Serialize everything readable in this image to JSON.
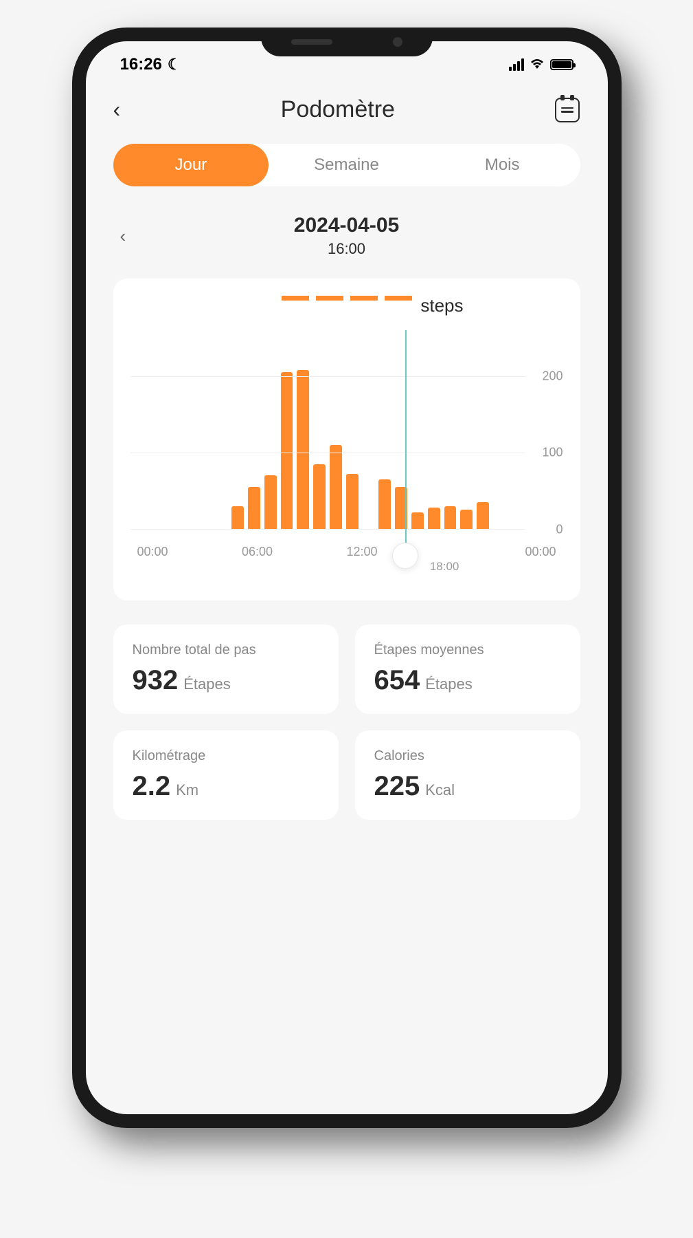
{
  "statusBar": {
    "time": "16:26"
  },
  "header": {
    "title": "Podomètre"
  },
  "tabs": [
    {
      "label": "Jour",
      "active": true
    },
    {
      "label": "Semaine",
      "active": false
    },
    {
      "label": "Mois",
      "active": false
    }
  ],
  "dateNav": {
    "date": "2024-04-05",
    "time": "16:00"
  },
  "chart_data": {
    "type": "bar",
    "tooltip_label": "steps",
    "categories": [
      "00:00",
      "01:00",
      "02:00",
      "03:00",
      "04:00",
      "05:00",
      "06:00",
      "07:00",
      "08:00",
      "09:00",
      "10:00",
      "11:00",
      "12:00",
      "13:00",
      "14:00",
      "15:00",
      "16:00",
      "17:00",
      "18:00",
      "19:00",
      "20:00",
      "21:00",
      "22:00",
      "23:00"
    ],
    "values": [
      0,
      0,
      0,
      0,
      0,
      0,
      30,
      55,
      70,
      205,
      208,
      85,
      110,
      72,
      0,
      65,
      55,
      22,
      28,
      30,
      25,
      35,
      0,
      0
    ],
    "xticks": [
      "00:00",
      "06:00",
      "12:00",
      "",
      "00:00"
    ],
    "cursor_xlabel": "18:00",
    "cursor_index": 16.2,
    "yticks": [
      0,
      100,
      200
    ],
    "ylim": [
      0,
      260
    ],
    "xlabel": "",
    "ylabel": "",
    "title": ""
  },
  "stats": [
    {
      "label": "Nombre total de pas",
      "value": "932",
      "unit": "Étapes"
    },
    {
      "label": "Étapes moyennes",
      "value": "654",
      "unit": "Étapes"
    },
    {
      "label": "Kilométrage",
      "value": "2.2",
      "unit": "Km"
    },
    {
      "label": "Calories",
      "value": "225",
      "unit": "Kcal"
    }
  ],
  "colors": {
    "accent": "#ff8a2b",
    "cursor": "#6ec9c3"
  }
}
